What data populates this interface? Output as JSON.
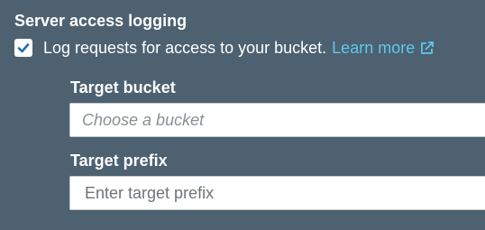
{
  "section": {
    "title": "Server access logging"
  },
  "logging": {
    "checked": true,
    "label": "Log requests for access to your bucket.",
    "learn_more": "Learn more"
  },
  "target_bucket": {
    "label": "Target bucket",
    "placeholder": "Choose a bucket"
  },
  "target_prefix": {
    "label": "Target prefix",
    "placeholder": "Enter target prefix"
  },
  "icons": {
    "checkbox": "checkmark-icon",
    "learn_more": "external-link-icon"
  },
  "colors": {
    "background": "#4d6170",
    "link": "#5ec8ee",
    "checkbox_check": "#1f6fb3"
  }
}
